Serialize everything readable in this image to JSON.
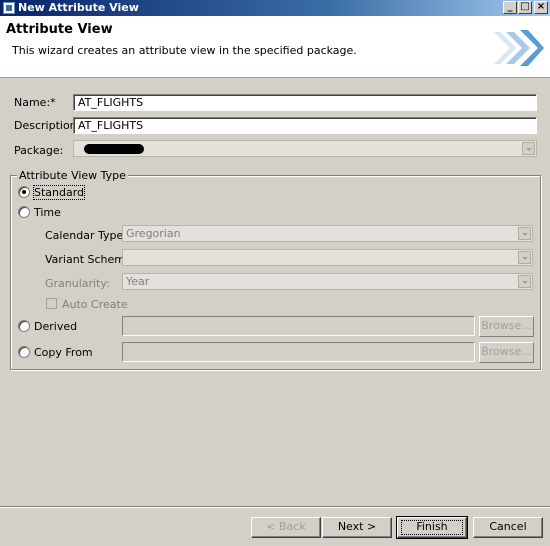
{
  "window": {
    "title": "New Attribute View",
    "minimize": "_",
    "maximize": "□",
    "close": "×"
  },
  "header": {
    "title": "Attribute View",
    "description": "This wizard creates an attribute view in the specified package."
  },
  "form": {
    "name_label": "Name:*",
    "name_value": "AT_FLIGHTS",
    "description_label": "Description:",
    "description_value": "AT_FLIGHTS",
    "package_label": "Package:",
    "package_value": ""
  },
  "view_type": {
    "legend": "Attribute View Type",
    "standard_label": "Standard",
    "time_label": "Time",
    "calendar_type_label": "Calendar Type:",
    "calendar_type_value": "Gregorian",
    "variant_schema_label": "Variant Schema:",
    "variant_schema_value": "",
    "granularity_label": "Granularity:",
    "granularity_value": "Year",
    "auto_create_label": "Auto Create",
    "derived_label": "Derived",
    "copy_from_label": "Copy From",
    "browse_label": "Browse...",
    "selected": "Standard"
  },
  "footer": {
    "back_label": "< Back",
    "next_label": "Next >",
    "finish_label": "Finish",
    "cancel_label": "Cancel"
  },
  "colors": {
    "dialog_bg": "#d4d0c8",
    "title_bar": "#0a246a",
    "wizard_arrow": "#5b9bd5"
  }
}
